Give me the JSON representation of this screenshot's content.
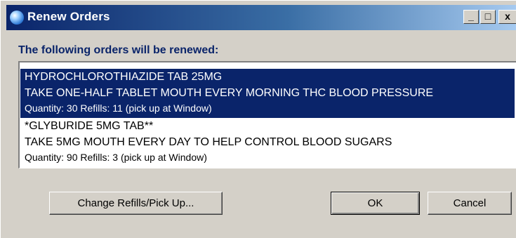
{
  "window": {
    "title": "Renew Orders",
    "controls": {
      "minimize": "_",
      "maximize": "□",
      "close": "x"
    }
  },
  "heading": "The following orders will be renewed:",
  "orders": [
    {
      "drug": "HYDROCHLOROTHIAZIDE TAB  25MG",
      "sig": "TAKE ONE-HALF TABLET MOUTH EVERY MORNING THC BLOOD PRESSURE",
      "details": "Quantity: 30 Refills: 11 (pick up at Window)",
      "selected": true
    },
    {
      "drug": "*GLYBURIDE 5MG TAB**",
      "sig": "TAKE 5MG MOUTH EVERY DAY TO HELP CONTROL BLOOD SUGARS",
      "details": "Quantity: 90 Refills: 3 (pick up at Window)",
      "selected": false
    }
  ],
  "buttons": {
    "change_refills": "Change Refills/Pick Up...",
    "ok": "OK",
    "cancel": "Cancel"
  },
  "colors": {
    "title_gradient_start": "#0a246a",
    "title_gradient_end": "#a6caf0",
    "heading": "#0a246a",
    "selection": "#0a246a",
    "dialog_bg": "#d4d0c8"
  }
}
